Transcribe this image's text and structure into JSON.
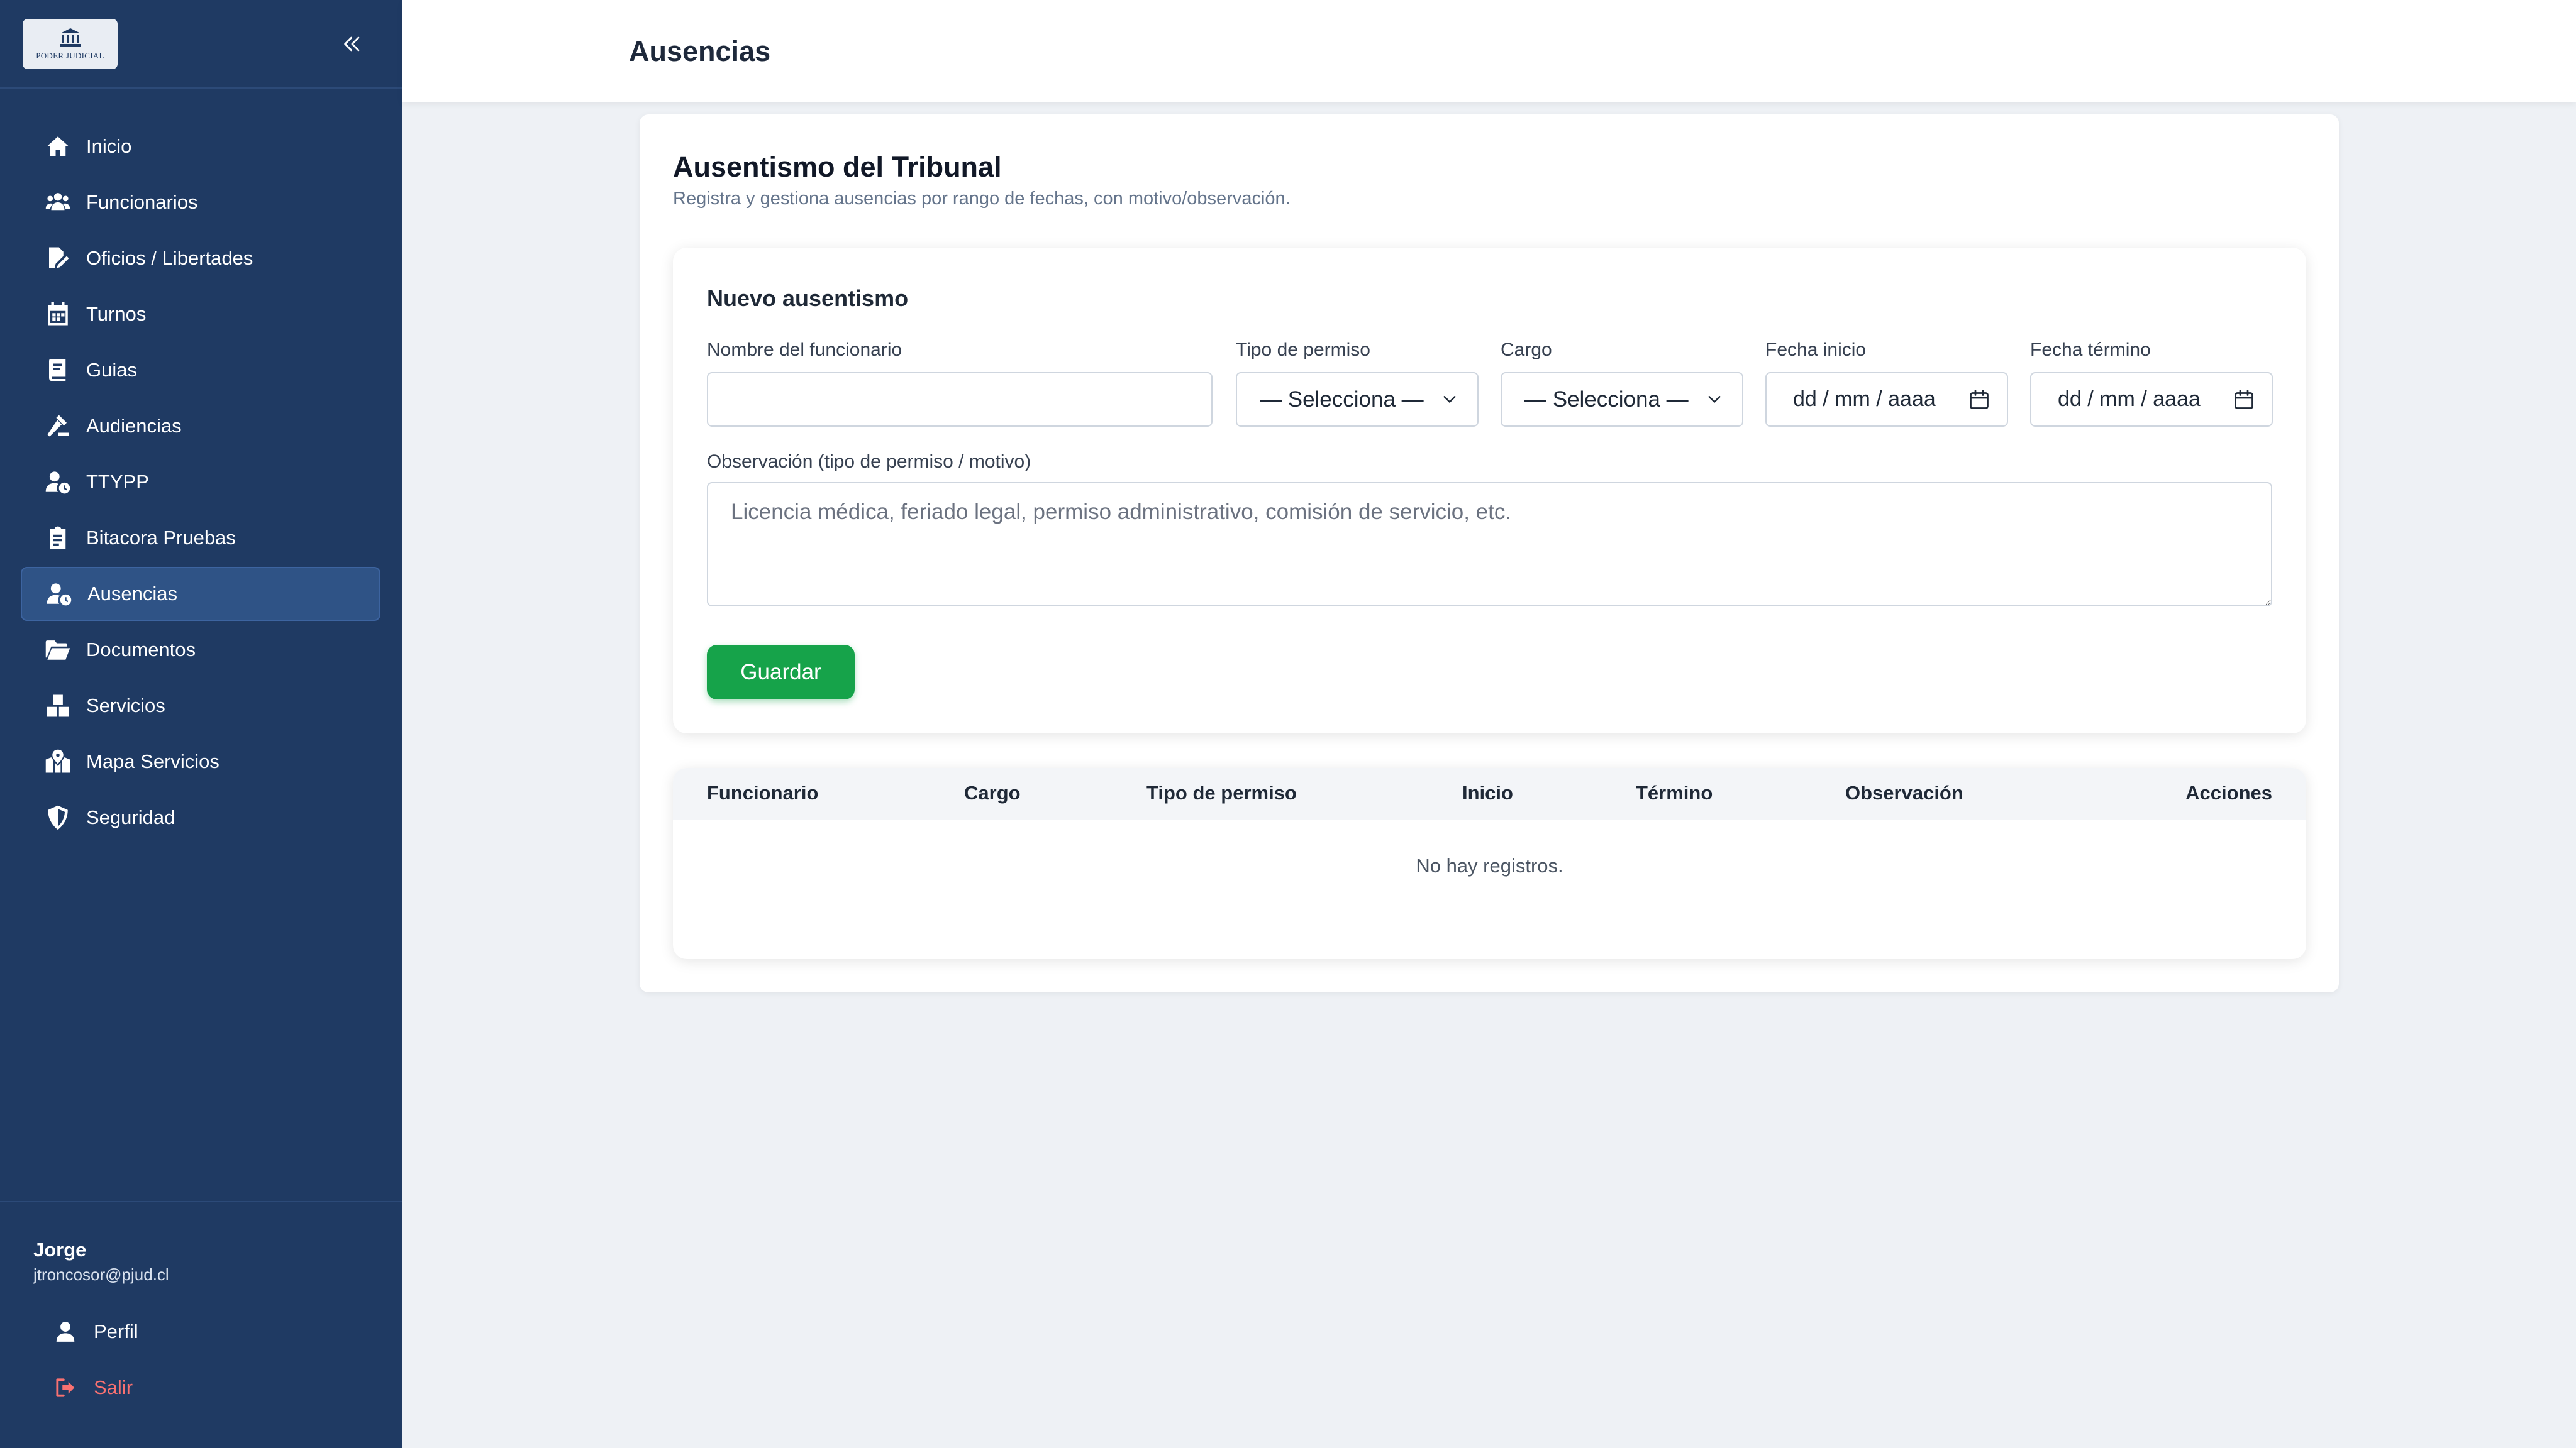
{
  "sidebar": {
    "logo_text": "PODER JUDICIAL",
    "items": [
      {
        "label": "Inicio",
        "icon": "home-icon"
      },
      {
        "label": "Funcionarios",
        "icon": "users-icon"
      },
      {
        "label": "Oficios / Libertades",
        "icon": "file-signature-icon"
      },
      {
        "label": "Turnos",
        "icon": "calendar-icon"
      },
      {
        "label": "Guias",
        "icon": "book-icon"
      },
      {
        "label": "Audiencias",
        "icon": "gavel-icon"
      },
      {
        "label": "TTYPP",
        "icon": "user-clock-icon"
      },
      {
        "label": "Bitacora Pruebas",
        "icon": "clipboard-icon"
      },
      {
        "label": "Ausencias",
        "icon": "user-clock-icon",
        "active": true
      },
      {
        "label": "Documentos",
        "icon": "folder-open-icon"
      },
      {
        "label": "Servicios",
        "icon": "boxes-icon"
      },
      {
        "label": "Mapa Servicios",
        "icon": "map-marked-icon"
      },
      {
        "label": "Seguridad",
        "icon": "shield-icon"
      }
    ],
    "user": {
      "name": "Jorge",
      "email": "jtroncosor@pjud.cl"
    },
    "profile_label": "Perfil",
    "logout_label": "Salir"
  },
  "header": {
    "title": "Ausencias"
  },
  "main": {
    "title": "Ausentismo del Tribunal",
    "subtitle": "Registra y gestiona ausencias por rango de fechas, con motivo/observación.",
    "form": {
      "title": "Nuevo ausentismo",
      "name_label": "Nombre del funcionario",
      "name_value": "",
      "permit_label": "Tipo de permiso",
      "permit_value": "— Selecciona —",
      "cargo_label": "Cargo",
      "cargo_value": "— Selecciona —",
      "start_label": "Fecha inicio",
      "start_value": "dd / mm / aaaa",
      "end_label": "Fecha término",
      "end_value": "dd / mm / aaaa",
      "obs_label": "Observación (tipo de permiso / motivo)",
      "obs_placeholder": "Licencia médica, feriado legal, permiso administrativo, comisión de servicio, etc.",
      "save_label": "Guardar"
    },
    "table": {
      "columns": [
        "Funcionario",
        "Cargo",
        "Tipo de permiso",
        "Inicio",
        "Término",
        "Observación",
        "Acciones"
      ],
      "empty_text": "No hay registros."
    }
  },
  "colors": {
    "sidebar_bg": "#1f3a63",
    "sidebar_active": "#2f5386",
    "primary_button": "#16a34a",
    "logout_text": "#f87171",
    "page_bg": "#eef1f5"
  }
}
